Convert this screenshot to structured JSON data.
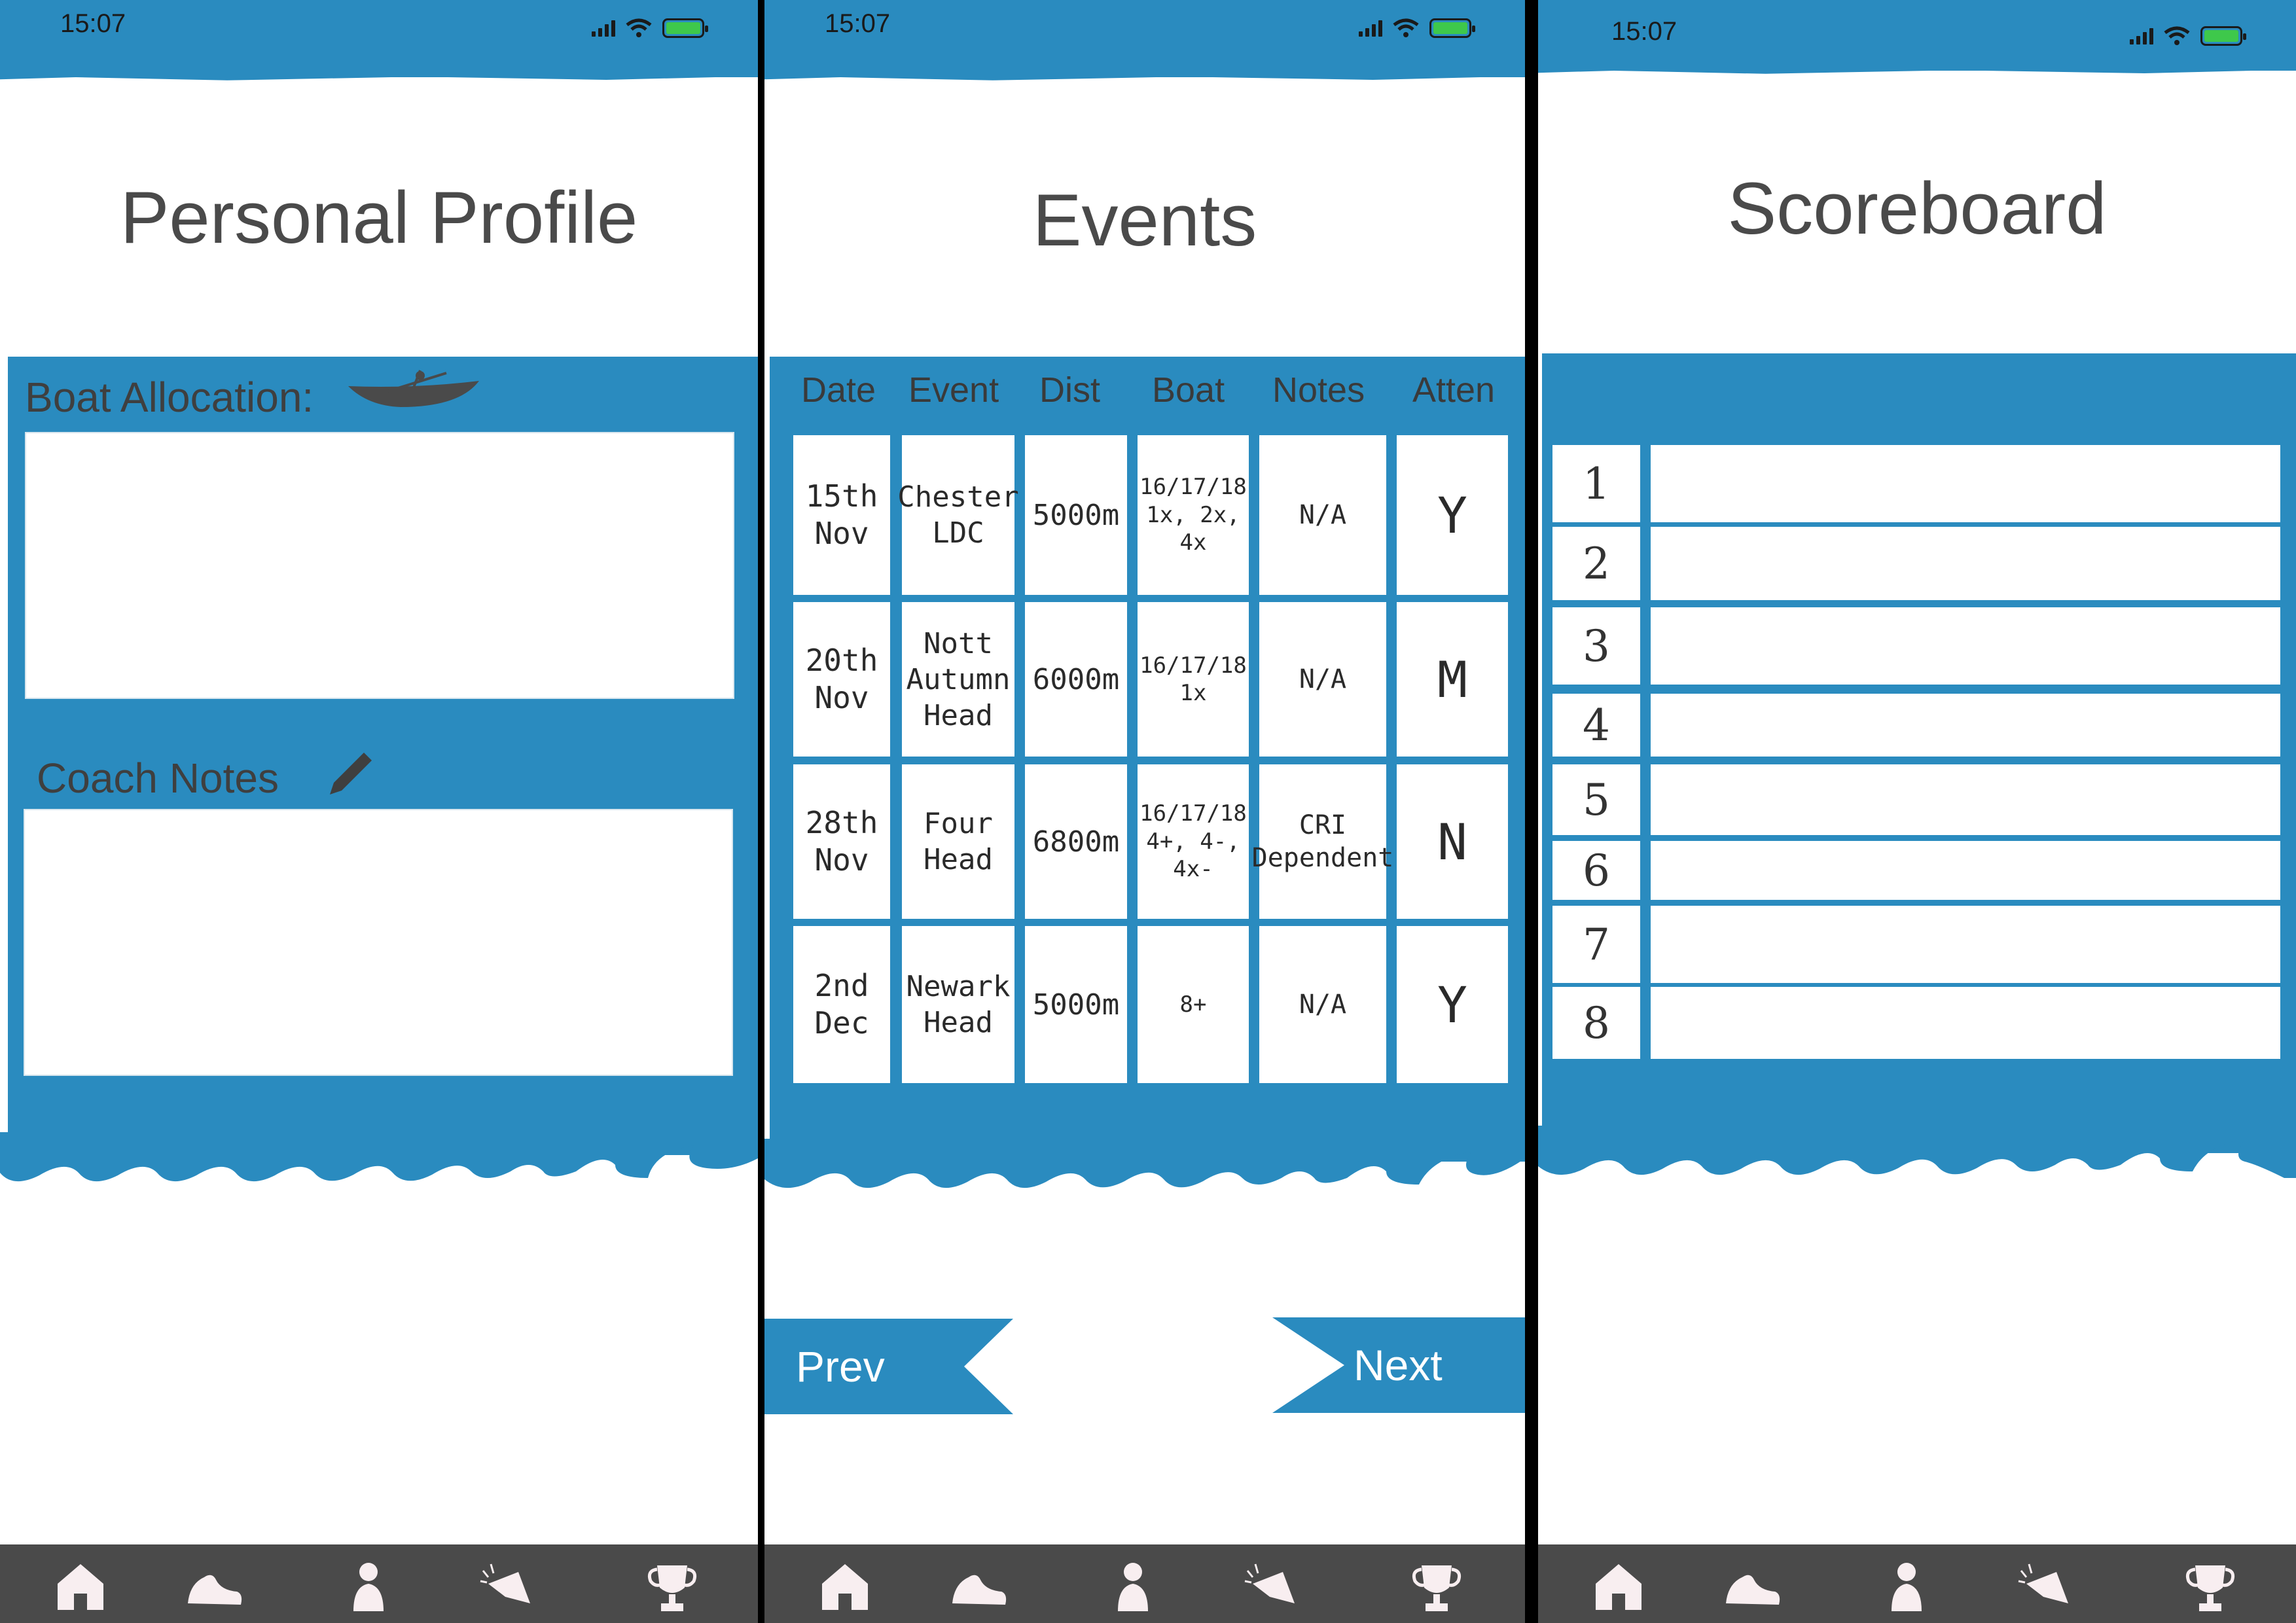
{
  "status_bar": {
    "time": "15:07"
  },
  "colors": {
    "accent": "#2a8bbf",
    "tabbar": "#4a4a4a",
    "battery": "#3ec84b"
  },
  "profile": {
    "title": "Personal Profile",
    "boat_allocation_label": "Boat Allocation:",
    "coach_notes_label": "Coach Notes",
    "boat_icon": "rowing-boat-icon",
    "notes_icon": "pencil-icon"
  },
  "events": {
    "title": "Events",
    "headers": [
      "Date",
      "Event",
      "Dist",
      "Boat",
      "Notes",
      "Atten"
    ],
    "rows": [
      {
        "date": "15th Nov",
        "event": "Chester LDC",
        "dist": "5000m",
        "boat": "16/17/18 1x, 2x, 4x",
        "notes": "N/A",
        "atten": "Y"
      },
      {
        "date": "20th Nov",
        "event": "Nott Autumn Head",
        "dist": "6000m",
        "boat": "16/17/18 1x",
        "notes": "N/A",
        "atten": "M"
      },
      {
        "date": "28th Nov",
        "event": "Four Head",
        "dist": "6800m",
        "boat": "16/17/18 4+, 4-, 4x-",
        "notes": "CRI Dependent",
        "atten": "N"
      },
      {
        "date": "2nd Dec",
        "event": "Newark Head",
        "dist": "5000m",
        "boat": "8+",
        "notes": "N/A",
        "atten": "Y"
      }
    ],
    "prev_label": "Prev",
    "next_label": "Next"
  },
  "scoreboard": {
    "title": "Scoreboard",
    "ranks": [
      "1",
      "2",
      "3",
      "4",
      "5",
      "6",
      "7",
      "8"
    ]
  },
  "tabbar": {
    "items": [
      "home-icon",
      "boat-shoe-icon",
      "person-icon",
      "megaphone-icon",
      "trophy-icon"
    ]
  }
}
